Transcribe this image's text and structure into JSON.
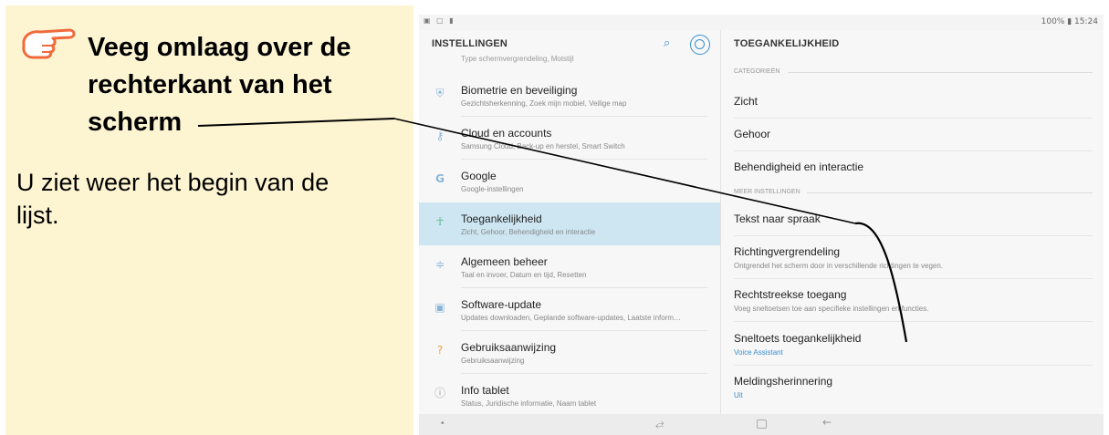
{
  "instruction": {
    "title_line1": "Veeg omlaag over de",
    "title_line2": "rechterkant van het",
    "title_line3": "scherm",
    "body_line1": "U ziet weer het begin van de",
    "body_line2": "lijst."
  },
  "status_bar": {
    "right": "100% ▮ 15:24"
  },
  "settings": {
    "title": "INSTELLINGEN",
    "cut_subtitle": "Type schermvergrendeling, Motstijl",
    "items": [
      {
        "title": "Biometrie en beveiliging",
        "subtitle": "Gezichtsherkenning, Zoek mijn mobiel, Veilige map",
        "icon": "shield-icon"
      },
      {
        "title": "Cloud en accounts",
        "subtitle": "Samsung Cloud, Back-up en herstel, Smart Switch",
        "icon": "key-icon"
      },
      {
        "title": "Google",
        "subtitle": "Google-instellingen",
        "icon": "google-icon"
      },
      {
        "title": "Toegankelijkheid",
        "subtitle": "Zicht, Gehoor, Behendigheid en interactie",
        "icon": "accessibility-icon"
      },
      {
        "title": "Algemeen beheer",
        "subtitle": "Taal en invoer, Datum en tijd, Resetten",
        "icon": "sliders-icon"
      },
      {
        "title": "Software-update",
        "subtitle": "Updates downloaden, Geplande software-updates, Laatste inform…",
        "icon": "update-icon"
      },
      {
        "title": "Gebruiksaanwijzing",
        "subtitle": "Gebruiksaanwijzing",
        "icon": "manual-icon"
      },
      {
        "title": "Info tablet",
        "subtitle": "Status, Juridische informatie, Naam tablet",
        "icon": "info-icon"
      }
    ]
  },
  "accessibility": {
    "title": "TOEGANKELIJKHEID",
    "categories_label": "CATEGORIEËN",
    "categories": [
      "Zicht",
      "Gehoor",
      "Behendigheid en interactie"
    ],
    "more_label": "MEER INSTELLINGEN",
    "more": [
      {
        "title": "Tekst naar spraak",
        "subtitle": ""
      },
      {
        "title": "Richtingvergrendeling",
        "subtitle": "Ontgrendel het scherm door in verschillende richtingen te vegen."
      },
      {
        "title": "Rechtstreekse toegang",
        "subtitle": "Voeg sneltoetsen toe aan specifieke instellingen en functies."
      },
      {
        "title": "Sneltoets toegankelijkheid",
        "subtitle": "Voice Assistant"
      },
      {
        "title": "Meldingsherinnering",
        "subtitle": "Uit"
      }
    ]
  },
  "colors": {
    "panel": "#fdf5d2",
    "hand": "#f06a3c",
    "selected": "#cde6f2",
    "accent": "#3a8fd0"
  }
}
